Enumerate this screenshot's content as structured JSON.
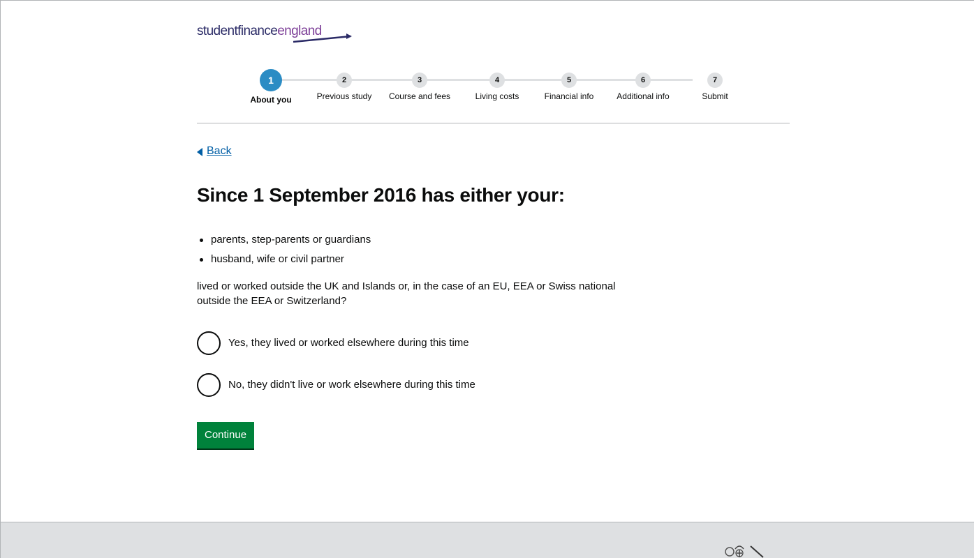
{
  "logo": {
    "word1": "student",
    "word2": "finance",
    "word3": "england",
    "accent": "#7d3f98"
  },
  "steps": [
    {
      "number": "1",
      "label": "About you",
      "active": true
    },
    {
      "number": "2",
      "label": "Previous study",
      "active": false
    },
    {
      "number": "3",
      "label": "Course and fees",
      "active": false
    },
    {
      "number": "4",
      "label": "Living costs",
      "active": false
    },
    {
      "number": "5",
      "label": "Financial info",
      "active": false
    },
    {
      "number": "6",
      "label": "Additional info",
      "active": false
    },
    {
      "number": "7",
      "label": "Submit",
      "active": false
    }
  ],
  "back": {
    "label": "Back"
  },
  "question": {
    "title": "Since 1 September 2016 has either your:",
    "bullets": [
      "parents, step-parents or guardians",
      "husband, wife or civil partner"
    ],
    "text": "lived or worked outside the UK and Islands or, in the case of an EU, EEA or Swiss national outside the EEA or Switzerland?"
  },
  "options": {
    "yes": "Yes, they lived or worked elsewhere during this time",
    "no": "No, they didn't live or work elsewhere during this time"
  },
  "continue_label": "Continue",
  "colors": {
    "primary": "#00823b",
    "link": "#005ea5",
    "active_step": "#2b8cc4",
    "footer": "#dee0e2"
  }
}
